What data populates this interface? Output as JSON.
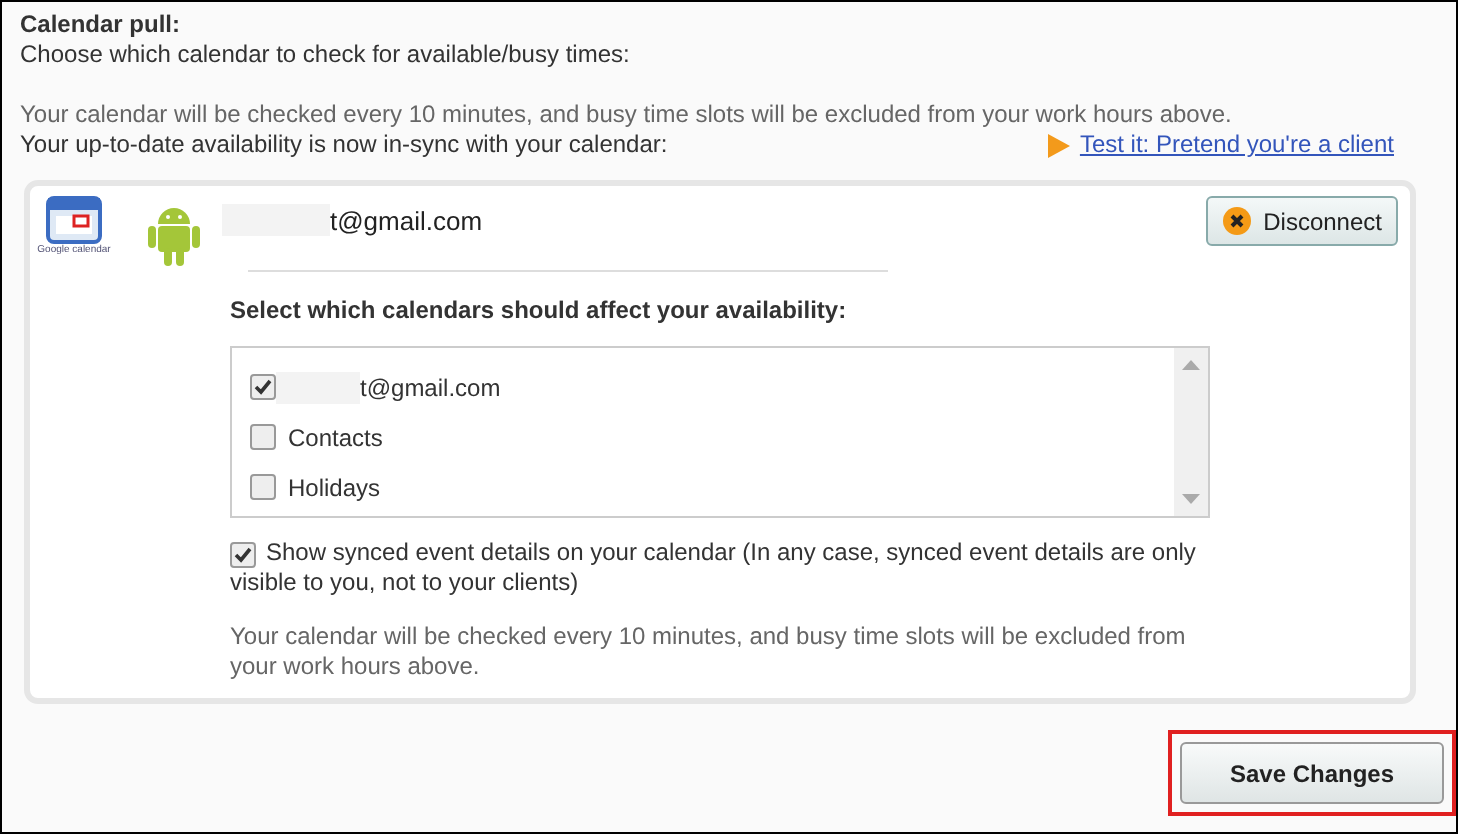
{
  "heading": "Calendar pull:",
  "instructions": "Choose which calendar to check for available/busy times:",
  "check_note": "Your calendar will be checked every 10 minutes, and busy time slots will be excluded from your work hours above.",
  "sync_note": "Your up-to-date availability is now in-sync with your calendar:",
  "test_link": "Test it: Pretend you're a client",
  "account": {
    "logo_caption": "Google calendar",
    "email": "t@gmail.com",
    "disconnect": "Disconnect"
  },
  "calendars_label": "Select which calendars should affect your availability:",
  "calendars": [
    {
      "label": "t@gmail.com",
      "checked": true,
      "redacted": true
    },
    {
      "label": "Contacts",
      "checked": false,
      "redacted": false
    },
    {
      "label": "Holidays",
      "checked": false,
      "redacted": false
    }
  ],
  "show_details": {
    "label": "Show synced event details on your calendar (In any case, synced event details are only visible to you, not to your clients)",
    "checked": true
  },
  "footer_note": "Your calendar will be checked every 10 minutes, and busy time slots will be excluded from your work hours above.",
  "save_button": "Save Changes"
}
